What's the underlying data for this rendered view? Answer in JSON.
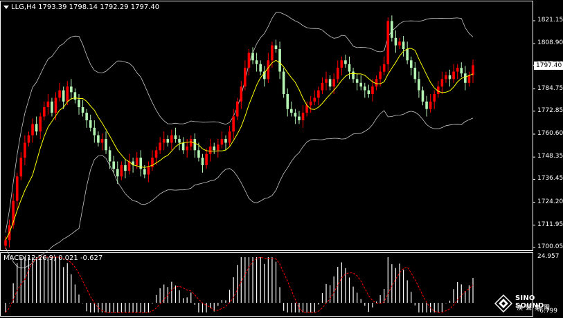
{
  "header": {
    "symbol": "LLG,H4",
    "ohlc": "1793.39 1798.14 1792.29 1797.40"
  },
  "macd": {
    "label": "MACD(12,26,9)",
    "values": "0.021 -0.627",
    "axis_top": "24.957",
    "axis_bottom": "-6.799"
  },
  "price_axis": {
    "labels": [
      "1821.15",
      "1808.90",
      "1797.40",
      "1784.75",
      "1772.85",
      "1760.60",
      "1748.35",
      "1736.45",
      "1724.20",
      "1711.95",
      "1700.05"
    ],
    "current": "1797.40"
  },
  "brand": {
    "name": "SINO SOUND",
    "name_cn": "漢聲集團"
  },
  "colors": {
    "bull": "#ff0000",
    "bear": "#b4f5b4",
    "ma": "#ffff00",
    "bands": "#c8c8c8",
    "signal": "#ff0000",
    "histogram": "#ffffff"
  },
  "chart_data": {
    "type": "candlestick",
    "ylim": [
      1700.05,
      1821.15
    ],
    "closes": [
      1704,
      1712,
      1725,
      1738,
      1748,
      1756,
      1760,
      1766,
      1762,
      1770,
      1775,
      1778,
      1772,
      1780,
      1784,
      1778,
      1786,
      1783,
      1779,
      1775,
      1772,
      1768,
      1764,
      1760,
      1756,
      1758,
      1752,
      1746,
      1742,
      1738,
      1744,
      1741,
      1746,
      1744,
      1748,
      1742,
      1739,
      1743,
      1748,
      1752,
      1756,
      1758,
      1756,
      1760,
      1758,
      1756,
      1752,
      1754,
      1758,
      1752,
      1748,
      1744,
      1750,
      1754,
      1752,
      1755,
      1758,
      1756,
      1762,
      1770,
      1778,
      1786,
      1796,
      1804,
      1800,
      1798,
      1794,
      1790,
      1800,
      1808,
      1806,
      1794,
      1782,
      1774,
      1772,
      1770,
      1768,
      1772,
      1776,
      1778,
      1780,
      1784,
      1788,
      1790,
      1786,
      1790,
      1796,
      1800,
      1798,
      1794,
      1790,
      1788,
      1786,
      1784,
      1782,
      1786,
      1790,
      1794,
      1798,
      1821,
      1812,
      1808,
      1810,
      1806,
      1800,
      1796,
      1790,
      1784,
      1778,
      1774,
      1778,
      1782,
      1786,
      1790,
      1792,
      1790,
      1794,
      1796,
      1793,
      1788,
      1792,
      1797.4
    ]
  }
}
